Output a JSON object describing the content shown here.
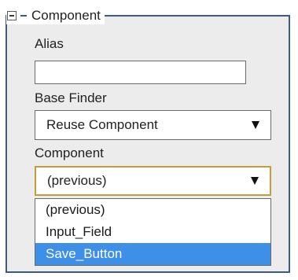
{
  "group": {
    "title": "Component"
  },
  "alias": {
    "label": "Alias",
    "value": "",
    "placeholder": ""
  },
  "base_finder": {
    "label": "Base Finder",
    "selected": "Reuse Component"
  },
  "component": {
    "label": "Component",
    "selected": "(previous)",
    "options": [
      "(previous)",
      "Input_Field",
      "Save_Button"
    ],
    "highlighted_option": "Save_Button"
  },
  "colors": {
    "group_border": "#3d5a84",
    "group_background": "#ececec",
    "focus_border": "#c79a3e",
    "highlight": "#3d8fe8"
  },
  "icons": {
    "collapse": "minus-box-icon",
    "dropdown": "caret-down-icon"
  }
}
